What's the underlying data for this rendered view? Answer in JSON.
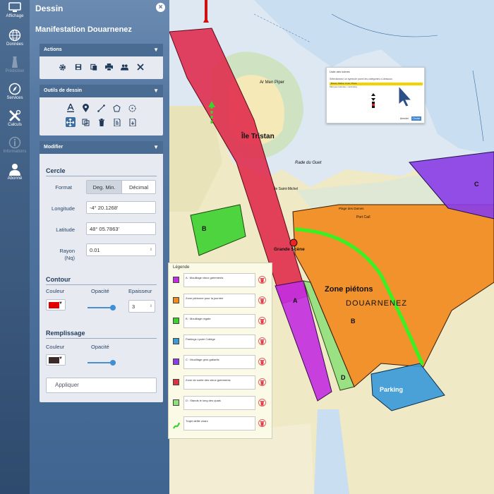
{
  "rail": [
    {
      "label": "Affichage",
      "icon": "monitor-icon",
      "dim": false
    },
    {
      "label": "Données",
      "icon": "globe-icon",
      "dim": false
    },
    {
      "label": "Prédiction",
      "icon": "lighthouse-icon",
      "dim": true
    },
    {
      "label": "Services",
      "icon": "compass-icon",
      "dim": false
    },
    {
      "label": "Calculs",
      "icon": "tools-icon",
      "dim": false
    },
    {
      "label": "Informations",
      "icon": "info-icon",
      "dim": true
    },
    {
      "label": "Abonné",
      "icon": "user-icon",
      "dim": false
    }
  ],
  "panel": {
    "header": "Dessin",
    "title": "Manifestation Douarnenez",
    "actions": {
      "title": "Actions",
      "tools": [
        "gear-icon",
        "save-icon",
        "copy-icon",
        "print-icon",
        "share-users-icon",
        "close-icon"
      ]
    },
    "drawing": {
      "title": "Outils de dessin",
      "row1": [
        "text-tool-icon",
        "marker-tool-icon",
        "line-tool-icon",
        "polygon-tool-icon",
        "circle-tool-icon"
      ],
      "row2": [
        "move-tool-icon",
        "duplicate-tool-icon",
        "delete-tool-icon",
        "import-tool-icon",
        "export-tool-icon"
      ]
    },
    "modifier": {
      "title": "Modifier",
      "section": "Cercle",
      "format_label": "Format",
      "format_options": [
        "Deg. Min.",
        "Décimal"
      ],
      "longitude_label": "Longitude",
      "longitude_value": "-4° 20.1268'",
      "latitude_label": "Latitude",
      "latitude_value": "48° 05.7863'",
      "radius_label": "Rayon",
      "radius_unit": "(Nq)",
      "radius_value": "0.01",
      "contour": {
        "title": "Contour",
        "color_label": "Couleur",
        "opacity_label": "Opacité",
        "thickness_label": "Epaisseur",
        "thickness_value": "3",
        "color": "#e00000",
        "opacity": 0.9
      },
      "fill": {
        "title": "Remplissage",
        "color_label": "Couleur",
        "opacity_label": "Opacité",
        "color": "#3a2a2a",
        "opacity": 0.9
      },
      "apply": "Appliquer"
    }
  },
  "legend": {
    "title": "Légende",
    "items": [
      {
        "text": "A : Mouillage vieux gréements",
        "color": "#c22ee0"
      },
      {
        "text": "Zone piétonne pour la journée",
        "color": "#f28a1e"
      },
      {
        "text": "B : Mouillage régate",
        "color": "#3bd12f"
      },
      {
        "text": "Parkings Lycée Collège",
        "color": "#3b9ad8"
      },
      {
        "text": "C : Mouillage gros gabarits",
        "color": "#8a3fe6"
      },
      {
        "text": "Zone de sortie des vieux gréements",
        "color": "#e0303f"
      },
      {
        "text": "D : Stands le long des quais",
        "color": "#8fe07a"
      },
      {
        "text": "Trajet défilé chars",
        "color": "#3bd12f"
      }
    ]
  },
  "popup": {
    "title": "Liste des icônes",
    "desc": "Sélectionnez un symbole parmi les catégories ci-dessous",
    "selected": "Bouée, Balise, Amer, Phare",
    "sub": "Marques latérales, cardinales",
    "cancel": "Annuler",
    "ok": "Choisir"
  },
  "map": {
    "labels": {
      "ile_tristan": "Île Tristan",
      "zone_pietons": "Zone piétons",
      "douarnenez": "DOUARNENEZ",
      "parking": "Parking",
      "grande_scene": "Grande Scène",
      "rade_du_guet": "Rade du Guet",
      "zone_a": "A",
      "zone_b": "B",
      "zone_b2": "B",
      "zone_c": "C",
      "zone_d": "D",
      "ar_men_piper": "Ar Men Piper",
      "ile_saint_michel": "Île Saint-Michel",
      "plage_des_dames": "Plage des Dames",
      "port_cail": "Port Caïl"
    }
  }
}
